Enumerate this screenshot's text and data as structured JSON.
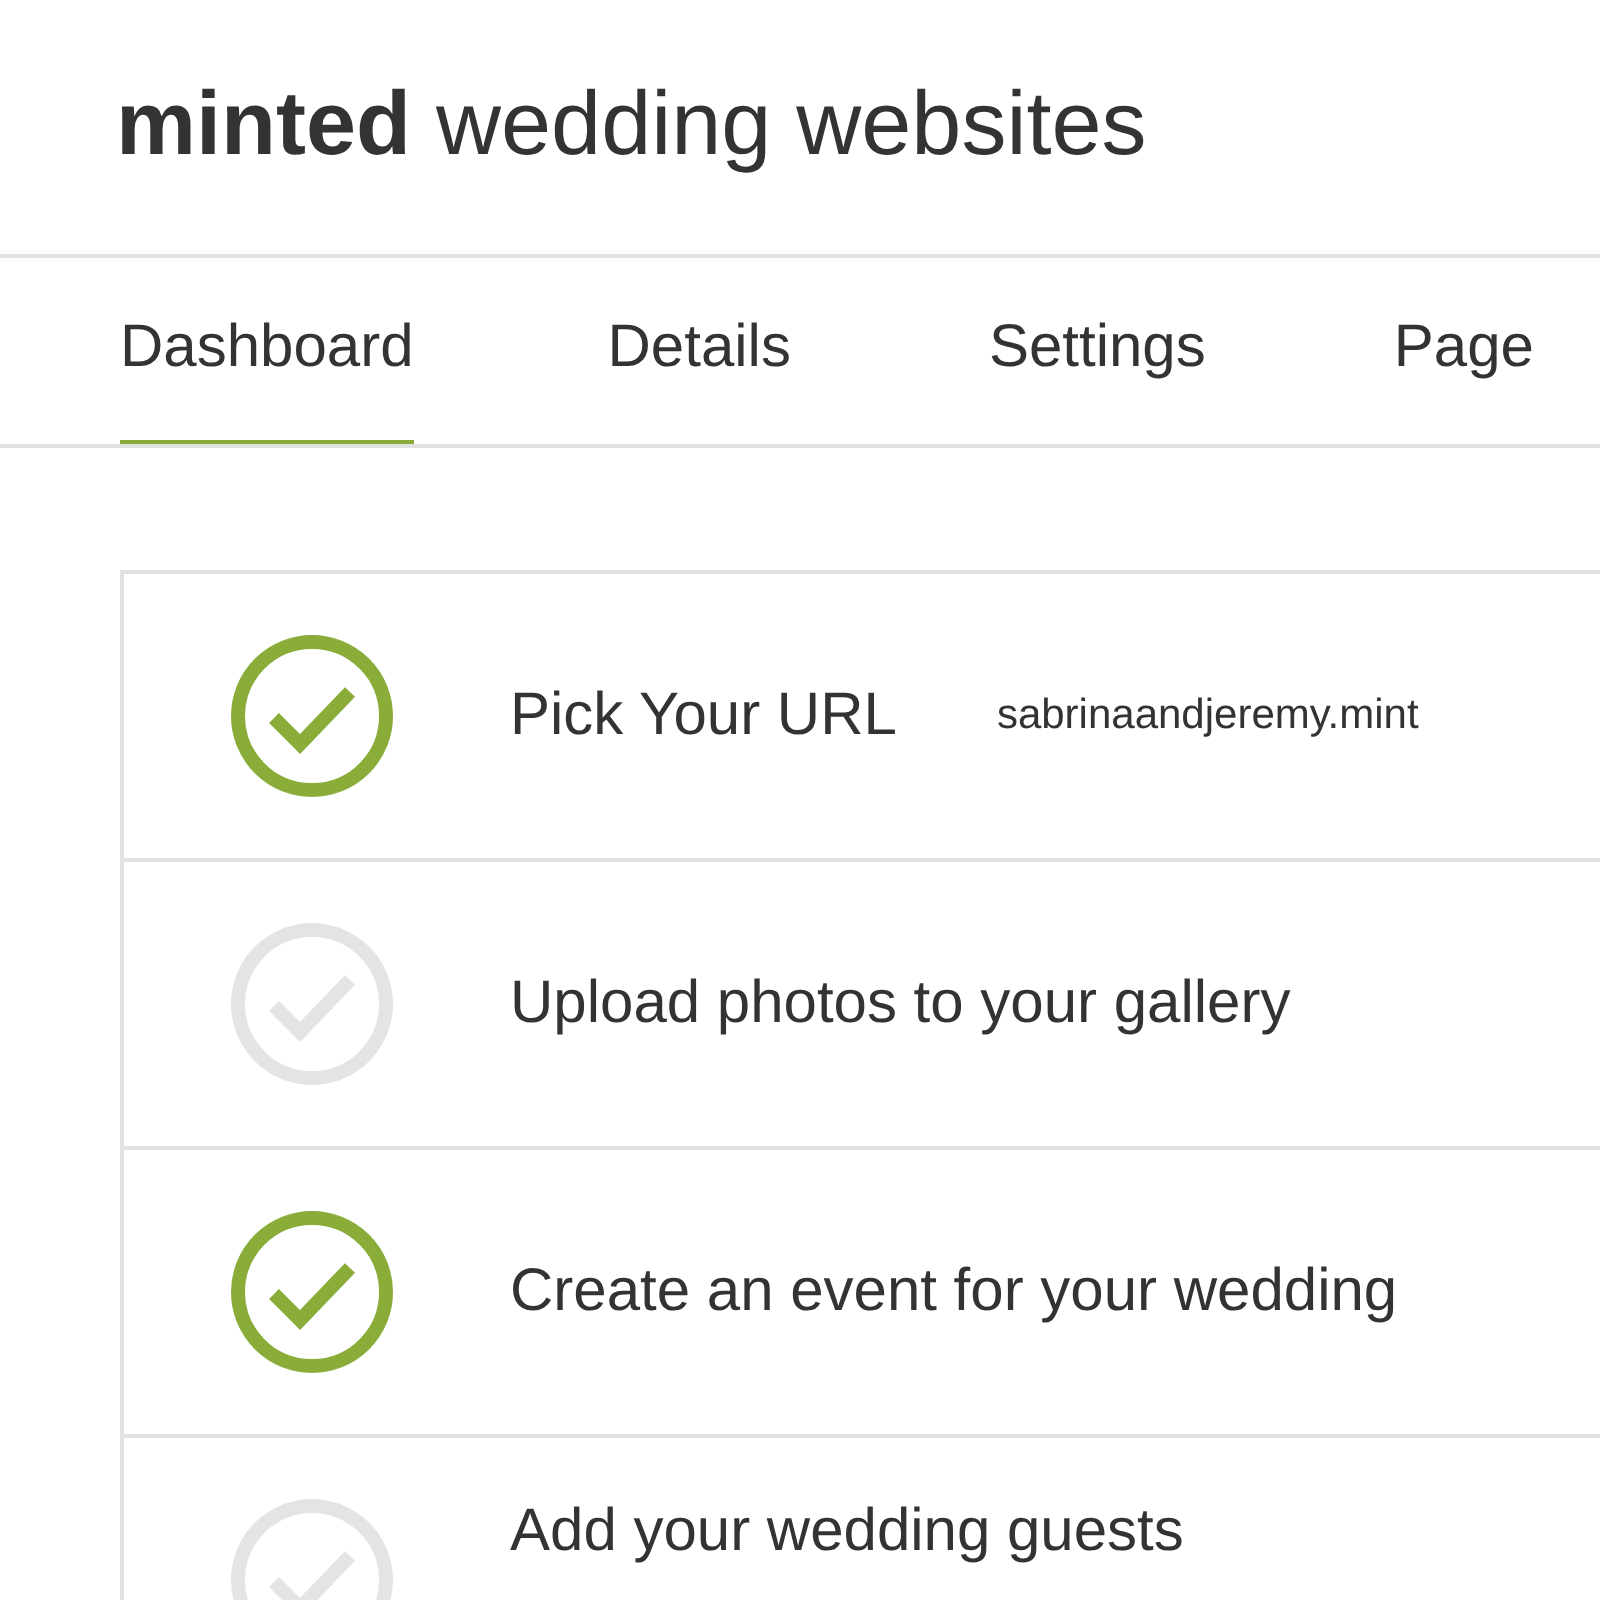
{
  "header": {
    "title": "**minted** wedding websites"
  },
  "tabs": [
    {
      "label": "Dashboard",
      "selected": true
    },
    {
      "label": "Details",
      "selected": false
    },
    {
      "label": "Settings",
      "selected": false
    },
    {
      "label": "Page",
      "selected": false
    }
  ],
  "tasks": [
    {
      "label": "Pick Your URL",
      "done": true,
      "value": "sabrinaandjeremy.mint"
    },
    {
      "label": "Upload photos to your gallery",
      "done": false
    },
    {
      "label": "Create an event for your wedding",
      "done": true
    },
    {
      "label": "Add your wedding guests",
      "done": false
    }
  ]
}
